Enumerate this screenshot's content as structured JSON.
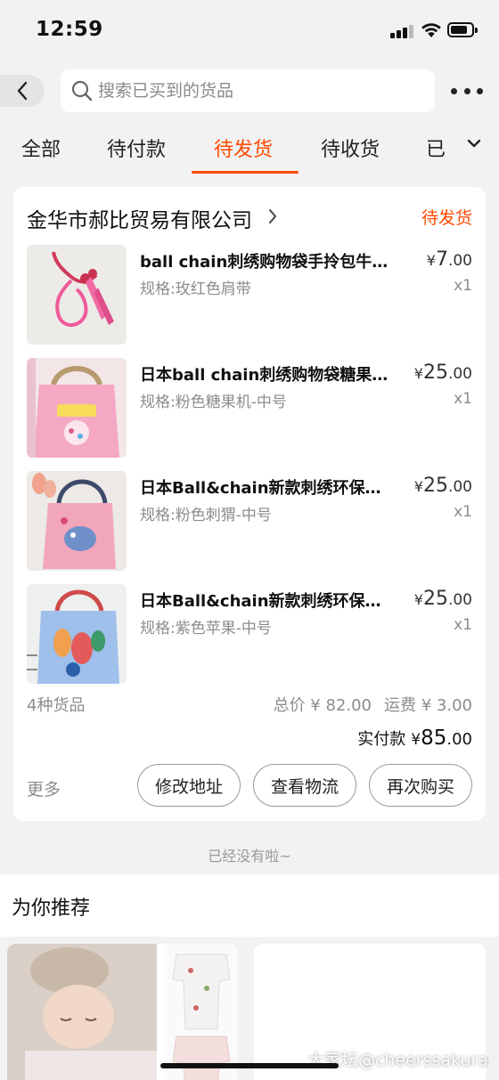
{
  "status_bar": {
    "time": "12:59"
  },
  "search": {
    "placeholder": "搜索已买到的货品"
  },
  "tabs": {
    "items": [
      {
        "label": "全部"
      },
      {
        "label": "待付款"
      },
      {
        "label": "待发货"
      },
      {
        "label": "待收货"
      },
      {
        "label": "已"
      }
    ],
    "active_index": 2
  },
  "order": {
    "shop_name": "金华市郝比贸易有限公司",
    "status": "待发货",
    "items": [
      {
        "title": "ball chain刺绣购物袋手拎包牛…",
        "spec": "规格:玫红色肩带",
        "price_symbol": "¥",
        "price_int": "7",
        "price_dec": ".00",
        "qty": "x1"
      },
      {
        "title": "日本ball chain刺绣购物袋糖果…",
        "spec": "规格:粉色糖果机-中号",
        "price_symbol": "¥",
        "price_int": "25",
        "price_dec": ".00",
        "qty": "x1"
      },
      {
        "title": "日本Ball&chain新款刺绣环保…",
        "spec": "规格:粉色刺猬-中号",
        "price_symbol": "¥",
        "price_int": "25",
        "price_dec": ".00",
        "qty": "x1"
      },
      {
        "title": "日本Ball&chain新款刺绣环保…",
        "spec": "规格:紫色苹果-中号",
        "price_symbol": "¥",
        "price_int": "25",
        "price_dec": ".00",
        "qty": "x1"
      }
    ],
    "item_count_text": "4种货品",
    "total_text": "总价 ¥ 82.00",
    "shipping_text": "运费 ¥ 3.00",
    "paid_label": "实付款",
    "paid_symbol": "¥",
    "paid_int": "85",
    "paid_dec": ".00",
    "more_label": "更多",
    "buttons": {
      "modify_address": "修改地址",
      "view_logistics": "查看物流",
      "buy_again": "再次购买"
    }
  },
  "end_note": "已经没有啦~",
  "recommend": {
    "title": "为你推荐"
  },
  "watermark": "大家坛@cheerssakura",
  "colors": {
    "accent": "#ff4a00",
    "background": "#f2f2f2",
    "card": "#ffffff",
    "muted_text": "#8c8c8c"
  },
  "icons": [
    "back-arrow-icon",
    "search-icon",
    "more-dots-icon",
    "chevron-down-icon",
    "chevron-right-icon",
    "signal-icon",
    "wifi-icon",
    "battery-icon"
  ]
}
